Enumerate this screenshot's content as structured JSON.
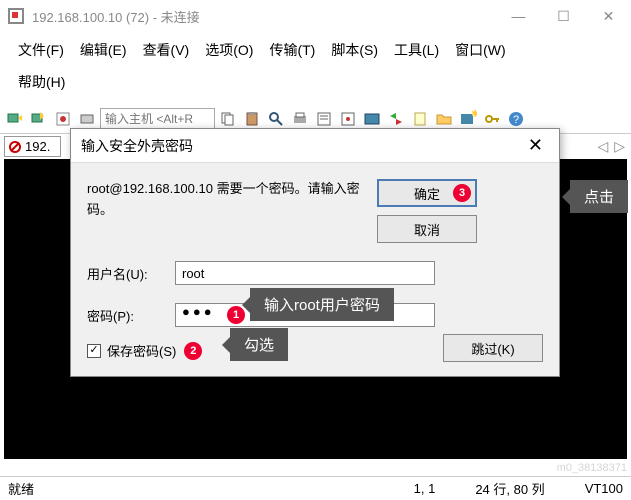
{
  "window": {
    "title": "192.168.100.10 (72) - 未连接",
    "min": "—",
    "max": "☐",
    "close": "✕"
  },
  "menus": {
    "file": "文件(F)",
    "edit": "编辑(E)",
    "view": "查看(V)",
    "options": "选项(O)",
    "transfer": "传输(T)",
    "script": "脚本(S)",
    "tools": "工具(L)",
    "window": "窗口(W)",
    "help": "帮助(H)"
  },
  "toolbar": {
    "host_placeholder": "输入主机 <Alt+R"
  },
  "tab": {
    "label": "192."
  },
  "nav": {
    "left": "◁",
    "right": "▷"
  },
  "dialog": {
    "title": "输入安全外壳密码",
    "prompt": "root@192.168.100.10 需要一个密码。请输入密码。",
    "ok": "确定",
    "cancel": "取消",
    "user_label": "用户名(U):",
    "user_value": "root",
    "pwd_label": "密码(P):",
    "pwd_value": "●●●",
    "save_label": "保存密码(S)",
    "check_mark": "✓",
    "skip": "跳过(K)",
    "close_x": "✕"
  },
  "annotations": {
    "b1": "1",
    "b2": "2",
    "b3": "3",
    "callout_pwd": "输入root用户密码",
    "callout_check": "勾选",
    "callout_ok": "点击"
  },
  "statusbar": {
    "ready": "就绪",
    "pos": "1, 1",
    "size": "24 行, 80 列",
    "term": "VT100"
  },
  "watermark": "m0_38138371"
}
